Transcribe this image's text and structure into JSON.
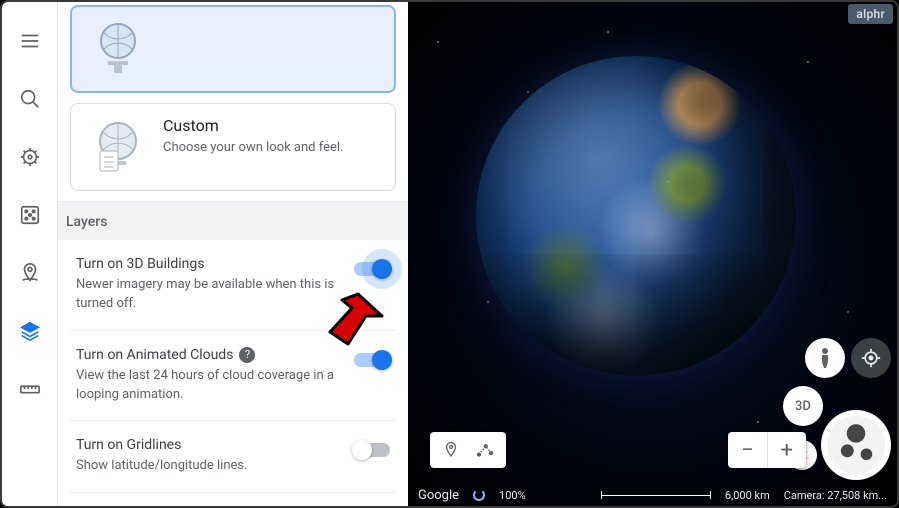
{
  "nav": {
    "items": [
      "menu",
      "search",
      "ship-wheel",
      "dice",
      "map-pin",
      "layers",
      "ruler"
    ],
    "active_index": 5
  },
  "panel": {
    "cards": [
      {
        "title": "",
        "desc": ""
      },
      {
        "title": "Custom",
        "desc": "Choose your own look and feel."
      }
    ],
    "section_header": "Layers",
    "layers": [
      {
        "title": "Turn on 3D Buildings",
        "desc": "Newer imagery may be available when this is turned off.",
        "on": true,
        "help": false
      },
      {
        "title": "Turn on Animated Clouds",
        "desc": "View the last 24 hours of cloud coverage in a looping animation.",
        "on": true,
        "help": true
      },
      {
        "title": "Turn on Gridlines",
        "desc": "Show latitude/longitude lines.",
        "on": false,
        "help": false
      }
    ]
  },
  "map": {
    "watermark": "alphr",
    "view3d_label": "3D",
    "zoom_out_label": "−",
    "zoom_in_label": "+",
    "brand": "Google",
    "progress": "100%",
    "scale_label": "6,000 km",
    "camera_label": "Camera: 27,508 km..."
  }
}
